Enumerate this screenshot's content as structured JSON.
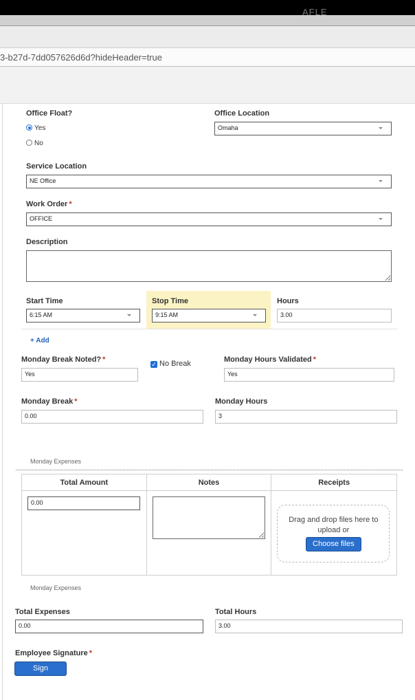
{
  "browser": {
    "title_fragment": "AFLE",
    "url": "3-b27d-7dd057626d6d?hideHeader=true"
  },
  "form": {
    "office_float": {
      "label": "Office Float?",
      "options": [
        "Yes",
        "No"
      ],
      "selected": "Yes"
    },
    "office_location": {
      "label": "Office Location",
      "value": "Omaha"
    },
    "service_location": {
      "label": "Service Location",
      "value": "NE Office"
    },
    "work_order": {
      "label": "Work Order",
      "required_mark": "*",
      "value": "OFFICE"
    },
    "description": {
      "label": "Description",
      "value": ""
    },
    "start_time": {
      "label": "Start Time",
      "value": "6:15 AM"
    },
    "stop_time": {
      "label": "Stop Time",
      "value": "9:15 AM",
      "highlight_color": "#fbf3c4"
    },
    "hours": {
      "label": "Hours",
      "value": "3.00"
    },
    "add_label": "+ Add",
    "monday_break_noted": {
      "label": "Monday Break Noted?",
      "required_mark": "*",
      "value": "Yes"
    },
    "no_break": {
      "label": "No Break",
      "checked": true
    },
    "monday_hours_validated": {
      "label": "Monday Hours Validated",
      "required_mark": "*",
      "value": "Yes"
    },
    "monday_break": {
      "label": "Monday Break",
      "required_mark": "*",
      "value": "0.00"
    },
    "monday_hours": {
      "label": "Monday Hours",
      "value": "3"
    },
    "expenses_section_top": "Monday Expenses",
    "expenses_table": {
      "headers": [
        "Total Amount",
        "Notes",
        "Receipts"
      ],
      "total_amount": "0.00",
      "notes": "",
      "dropzone_text": "Drag and drop files here to upload or",
      "choose_files_label": "Choose files"
    },
    "expenses_section_bottom": "Monday Expenses",
    "total_expenses": {
      "label": "Total Expenses",
      "value": "0.00"
    },
    "total_hours": {
      "label": "Total Hours",
      "value": "3.00"
    },
    "employee_signature": {
      "label": "Employee Signature",
      "required_mark": "*"
    },
    "sign_label": "Sign"
  },
  "colors": {
    "accent": "#2a6fcb",
    "required": "#c0392b",
    "link": "#2463b8"
  }
}
